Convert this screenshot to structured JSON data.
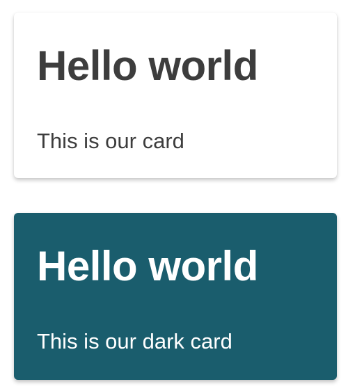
{
  "cards": [
    {
      "variant": "light",
      "title": "Hello world",
      "body": "This is our card",
      "background": "#ffffff",
      "text_color": "#3d3d3d"
    },
    {
      "variant": "dark",
      "title": "Hello world",
      "body": "This is our dark card",
      "background": "#1a5d6d",
      "text_color": "#ffffff"
    }
  ]
}
